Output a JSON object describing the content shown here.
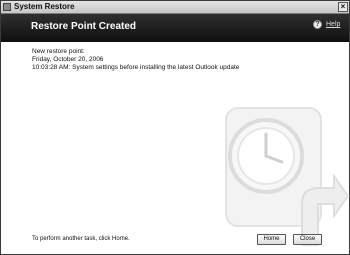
{
  "window": {
    "title": "System Restore",
    "close_label": "×"
  },
  "header": {
    "title": "Restore Point Created",
    "help_label": "Help",
    "help_icon": "?"
  },
  "content": {
    "heading": "New restore point:",
    "date": "Friday, October 20, 2006",
    "description": "10:03:28 AM: System settings before installing the latest Outlook update"
  },
  "footer": {
    "hint": "To perform another task, click Home."
  },
  "buttons": {
    "home": "Home",
    "close": "Close"
  }
}
